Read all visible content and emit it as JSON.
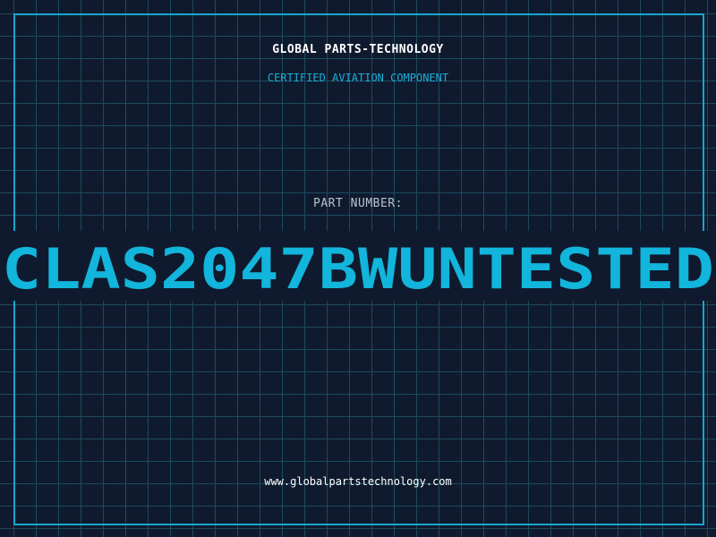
{
  "header": {
    "company": "GLOBAL PARTS-TECHNOLOGY",
    "subtitle": "CERTIFIED AVIATION COMPONENT"
  },
  "part": {
    "label": "PART NUMBER:",
    "number": "CLAS2047BWUNTESTED"
  },
  "footer": {
    "website": "www.globalpartstechnology.com"
  },
  "colors": {
    "background": "#101a2e",
    "grid": "#1b4a5e",
    "accent": "#12b5db",
    "frame": "#1aa6d0",
    "label": "#b7c3cf"
  }
}
